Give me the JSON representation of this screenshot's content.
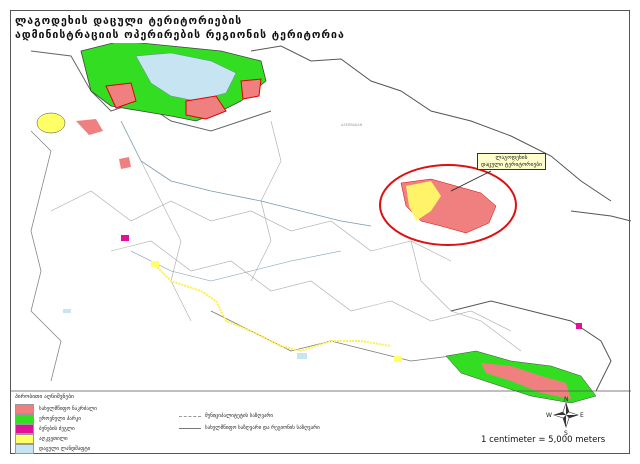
{
  "title": {
    "line1": "ლაგოდეხის დაცული ტერიტორიების",
    "line2": "ადმინისტრაციის ოპერირების რეგიონის ტერიტორია"
  },
  "callout": {
    "line1": "ლაგოდეხის",
    "line2": "დაცული ტერიტორიები"
  },
  "legend": {
    "heading": "პირობითი აღნიშვნები",
    "items": [
      {
        "label": "სახელმწიფო ნაკრძალი",
        "color": "#f08080"
      },
      {
        "label": "ეროვნული პარკი",
        "color": "#33dd22"
      },
      {
        "label": "ბუნების ძეგლი",
        "color": "#e0109a"
      },
      {
        "label": "აღკვეთილი",
        "color": "#ffff66"
      },
      {
        "label": "დაცული ლანდშაფტი",
        "color": "#c6e4f2"
      }
    ],
    "lines": [
      {
        "label": "მუნიციპალიტეტის საზღვარი",
        "style": "dashed"
      },
      {
        "label": "სახელმწიფო საზღვარი და რეგიონის საზღვარი",
        "style": "solid"
      }
    ]
  },
  "scale": "1 centimeter = 5,000 meters",
  "compass": {
    "n": "N",
    "s": "S",
    "e": "E",
    "w": "W"
  },
  "colors": {
    "reserve": "#f08080",
    "national_park": "#33dd22",
    "monument": "#e0109a",
    "sanctuary": "#ffff66",
    "landscape": "#c6e4f2",
    "highlight": "#dd1111",
    "border": "#555555",
    "river": "#7a9aaa"
  }
}
